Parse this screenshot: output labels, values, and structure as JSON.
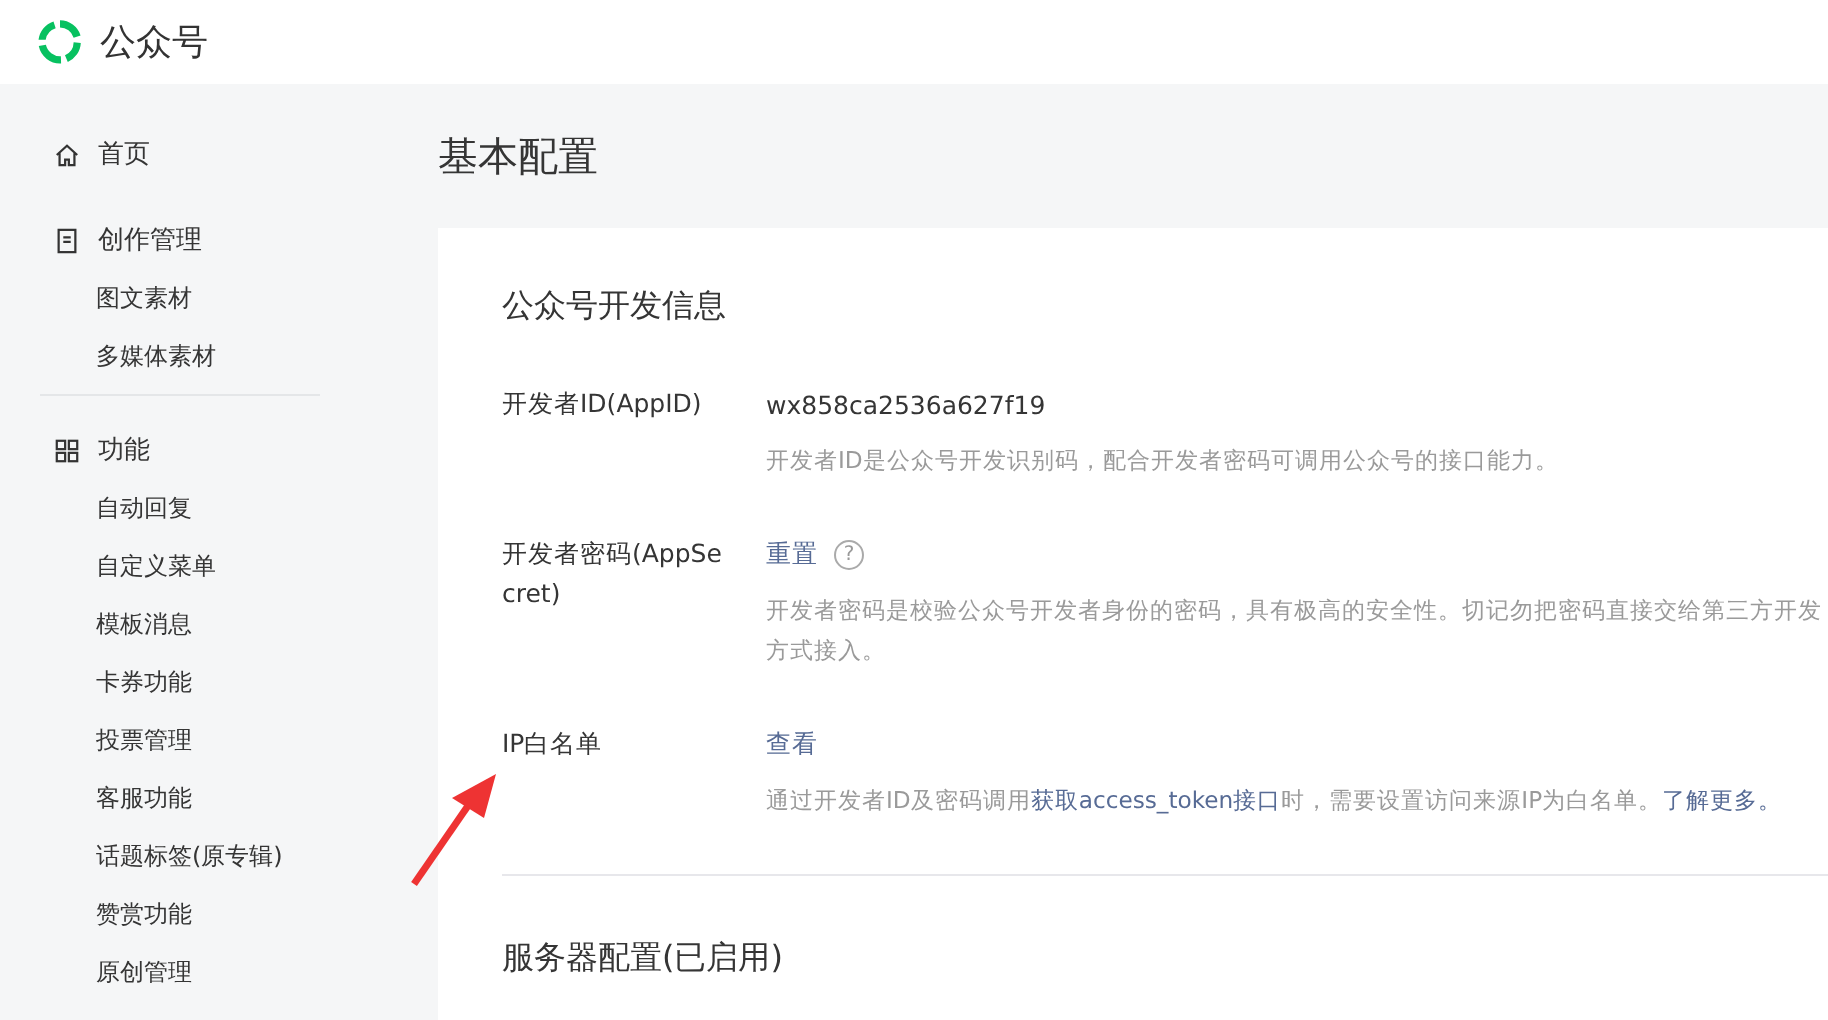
{
  "header": {
    "brand": "公众号"
  },
  "sidebar": {
    "groups": [
      {
        "kind": "home",
        "label": "首页"
      },
      {
        "kind": "doc",
        "label": "创作管理",
        "items": [
          "图文素材",
          "多媒体素材"
        ]
      },
      {
        "kind": "grid",
        "label": "功能",
        "items": [
          "自动回复",
          "自定义菜单",
          "模板消息",
          "卡券功能",
          "投票管理",
          "客服功能",
          "话题标签(原专辑)",
          "赞赏功能",
          "原创管理"
        ]
      }
    ]
  },
  "page_title": "基本配置",
  "sections": [
    {
      "title": "公众号开发信息",
      "rows": [
        {
          "label": "开发者ID(AppID)",
          "value": "wx858ca2536a627f19",
          "kind": "text",
          "description": [
            "开发者ID是公众号开发识别码，配合开发者密码可调用公众号的接口能力。"
          ]
        },
        {
          "label": "开发者密码(AppSecret)",
          "value": "重置",
          "kind": "link",
          "help": "?",
          "description": [
            "开发者密码是校验公众号开发者身份的密码，具有极高的安全性。切记勿把密码直接交给第三方开发",
            "方式接入。"
          ]
        },
        {
          "label": "IP白名单",
          "value": "查看",
          "kind": "link",
          "description": [
            "通过开发者ID及密码调用**获取access_token接口**时，需要设置访问来源IP为白名单。"
          ],
          "link": "了解更多。"
        }
      ]
    },
    {
      "title": "服务器配置(已启用)"
    }
  ]
}
